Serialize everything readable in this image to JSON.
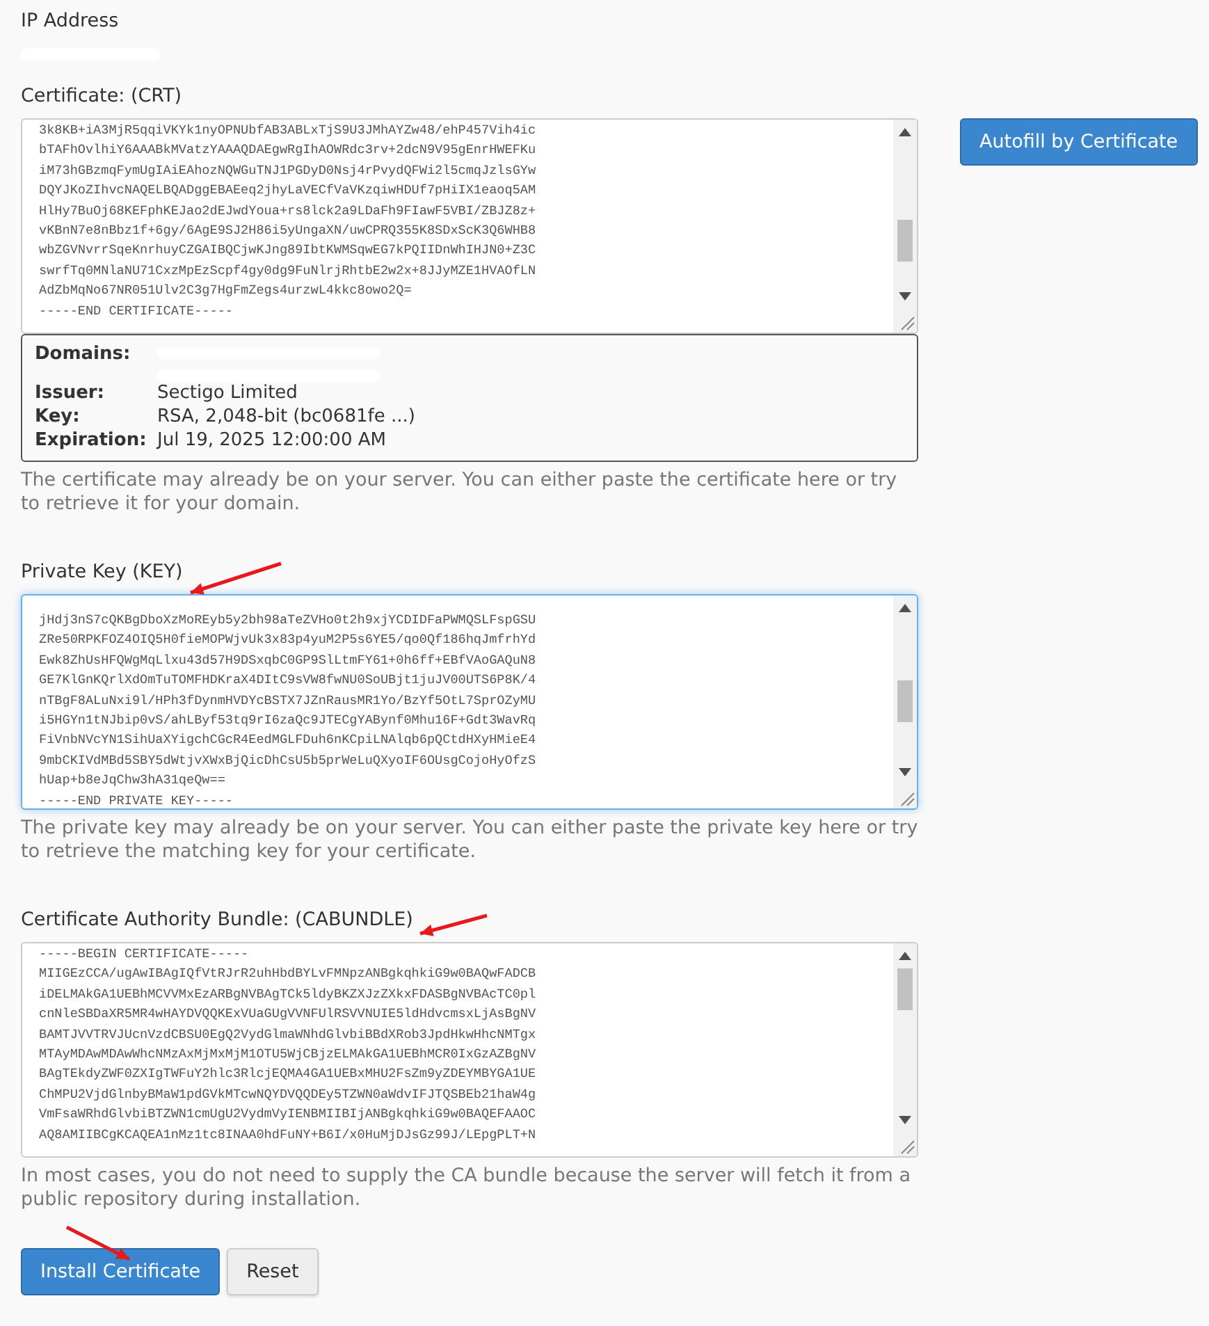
{
  "ip_address": {
    "label": "IP Address",
    "kind": "redacted"
  },
  "certificate": {
    "label": "Certificate: (CRT)",
    "focused": false,
    "lines": [
      "3k8KB+iA3MjR5qqiVKYk1nyOPNUbfAB3ABLxTjS9U3JMhAYZw48/ehP457Vih4ic",
      "bTAFhOvlhiY6AAABkMVatzYAAAQDAEgwRgIhAOWRdc3rv+2dcN9V95gEnrHWEFKu",
      "iM73hGBzmqFymUgIAiEAhozNQWGuTNJ1PGDyD0Nsj4rPvydQFWi2l5cmqJzlsGYw",
      "DQYJKoZIhvcNAQELBQADggEBAEeq2jhyLaVECfVaVKzqiwHDUf7pHiIX1eaoq5AM",
      "HlHy7BuOj68KEFphKEJao2dEJwdYoua+rs8lck2a9LDaFh9FIawF5VBI/ZBJZ8z+",
      "vKBnN7e8nBbz1f+6gy/6AgE9SJ2H86i5yUngaXN/uwCPRQ355K8SDxScK3Q6WHB8",
      "wbZGVNvrrSqeKnrhuyCZGAIBQCjwKJng89IbtKWMSqwEG7kPQIIDnWhIHJN0+Z3C",
      "swrfTq0MNlaNU71CxzMpEzScpf4gy0dg9FuNlrjRhtbE2w2x+8JJyMZE1HVAOfLN",
      "AdZbMqNo67NR051Ulv2C3g7HgFmZegs4urzwL4kkc8owo2Q=",
      "-----END CERTIFICATE-----"
    ],
    "details": [
      {
        "label": "Domains:",
        "kind": "redacted"
      },
      {
        "label": "Issuer:",
        "kind": "text",
        "value": "Sectigo Limited"
      },
      {
        "label": "Key:",
        "kind": "text",
        "value": "RSA, 2,048-bit (bc0681fe ...)"
      },
      {
        "label": "Expiration:",
        "kind": "text",
        "value": "Jul 19, 2025 12:00:00 AM"
      }
    ],
    "help": "The certificate may already be on your server. You can either paste the certificate here or try to retrieve it for your domain."
  },
  "autofill_button": "Autofill by Certificate",
  "private_key": {
    "label": "Private Key (KEY)",
    "marked": true,
    "focused": true,
    "lines": [
      "jHdj3nS7cQKBgDboXzMoREyb5y2bh98aTeZVHo0t2h9xjYCDIDFaPWMQSLFspGSU",
      "ZRe50RPKFOZ4OIQ5H0fieMOPWjvUk3x83p4yuM2P5s6YE5/qo0Qf186hqJmfrhYd",
      "Ewk8ZhUsHFQWgMqLlxu43d57H9DSxqbC0GP9SlLtmFY61+0h6ff+EBfVAoGAQuN8",
      "GE7KlGnKQrlXdOmTuTOMFHDKraX4DItC9sVW8fwNU0SoUBjt1juJV00UTS6P8K/4",
      "nTBgF8ALuNxi9l/HPh3fDynmHVDYcBSTX7JZnRausMR1Yo/BzYf5OtL7SprOZyMU",
      "i5HGYn1tNJbip0vS/ahLByf53tq9rI6zaQc9JTECgYABynf0Mhu16F+Gdt3WavRq",
      "FiVnbNVcYN1SihUaXYigchCGcR4EedMGLFDuh6nKCpiLNAlqb6pQCtdHXyHMieE4",
      "9mbCKIVdMBd5SBY5dWtjvXWxBjQicDhCsU5b5prWeLuQXyoIF6OUsgCojoHyOfzS",
      "hUap+b8eJqChw3hA31qeQw==",
      "-----END PRIVATE KEY-----"
    ],
    "help": "The private key may already be on your server. You can either paste the private key here or try to retrieve the matching key for your certificate."
  },
  "ca_bundle": {
    "label": "Certificate Authority Bundle: (CABUNDLE)",
    "marked": true,
    "focused": false,
    "lines": [
      "-----BEGIN CERTIFICATE-----",
      "MIIGEzCCA/ugAwIBAgIQfVtRJrR2uhHbdBYLvFMNpzANBgkqhkiG9w0BAQwFADCB",
      "iDELMAkGA1UEBhMCVVMxEzARBgNVBAgTCk5ldyBKZXJzZXkxFDASBgNVBAcTC0pl",
      "cnNleSBDaXR5MR4wHAYDVQQKExVUaGUgVVNFUlRSVVNUIE5ldHdvcmsxLjAsBgNV",
      "BAMTJVVTRVJUcnVzdCBSU0EgQ2VydGlmaWNhdGlvbiBBdXRob3JpdHkwHhcNMTgx",
      "MTAyMDAwMDAwWhcNMzAxMjMxMjM1OTU5WjCBjzELMAkGA1UEBhMCR0IxGzAZBgNV",
      "BAgTEkdyZWF0ZXIgTWFuY2hlc3RlcjEQMA4GA1UEBxMHU2FsZm9yZDEYMBYGA1UE",
      "ChMPU2VjdGlnbyBMaW1pdGVkMTcwNQYDVQQDEy5TZWN0aWdvIFJTQSBEb21haW4g",
      "VmFsaWRhdGlvbiBTZWN1cmUgU2VydmVyIENBMIIBIjANBgkqhkiG9w0BAQEFAAOC",
      "AQ8AMIIBCgKCAQEA1nMz1tc8INAA0hdFuNY+B6I/x0HuMjDJsGz99J/LEpgPLT+N"
    ],
    "help": "In most cases, you do not need to supply the CA bundle because the server will fetch it from a public repository during installation."
  },
  "buttons": [
    {
      "label": "Install Certificate",
      "kind": "primary",
      "marked": true
    },
    {
      "label": "Reset",
      "kind": "default",
      "marked": false
    }
  ]
}
